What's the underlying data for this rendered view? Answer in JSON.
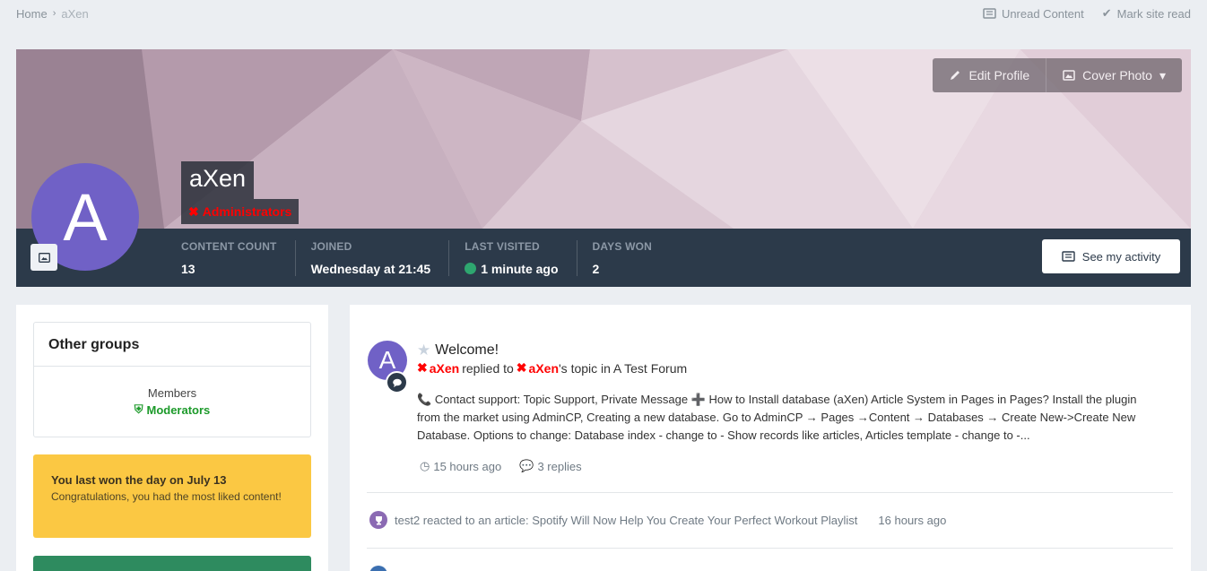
{
  "breadcrumb": {
    "home": "Home",
    "current": "aXen"
  },
  "top_actions": {
    "unread": "Unread Content",
    "mark_read": "Mark site read"
  },
  "cover": {
    "edit_profile": "Edit Profile",
    "cover_photo": "Cover Photo"
  },
  "profile": {
    "avatar_letter": "A",
    "name": "aXen",
    "group": "Administrators",
    "group_color": "#ff0000"
  },
  "stats": [
    {
      "label": "CONTENT COUNT",
      "value": "13"
    },
    {
      "label": "JOINED",
      "value": "Wednesday at 21:45"
    },
    {
      "label": "LAST VISITED",
      "value": "1 minute ago"
    },
    {
      "label": "DAYS WON",
      "value": "2"
    }
  ],
  "activity_button": "See my activity",
  "sidebar": {
    "groups_title": "Other groups",
    "groups_label": "Members",
    "moderators": "Moderators",
    "won_title": "You last won the day on July 13",
    "won_text": "Congratulations, you had the most liked content!"
  },
  "feed": {
    "entry": {
      "avatar_letter": "A",
      "title": "Welcome!",
      "user": "aXen",
      "replied_to": "replied to",
      "topic_owner": "aXen",
      "topic_suffix": "'s topic in",
      "forum": "A Test Forum",
      "excerpt": "Contact support: Topic Support, Private Message ➕ How to Install database (aXen) Article System in Pages in Pages? Install the plugin from the market using AdminCP, Creating a new database. Go to AdminCP → Pages →Content → Databases → Create New->Create New Database. Options to change: Database index - change to - Show records like articles, Articles template - change to -...",
      "time": "15 hours ago",
      "replies": "3 replies"
    },
    "reaction": {
      "text": "test2 reacted to an article: Spotify Will Now Help You Create Your Perfect Workout Playlist",
      "time": "16 hours ago"
    }
  }
}
